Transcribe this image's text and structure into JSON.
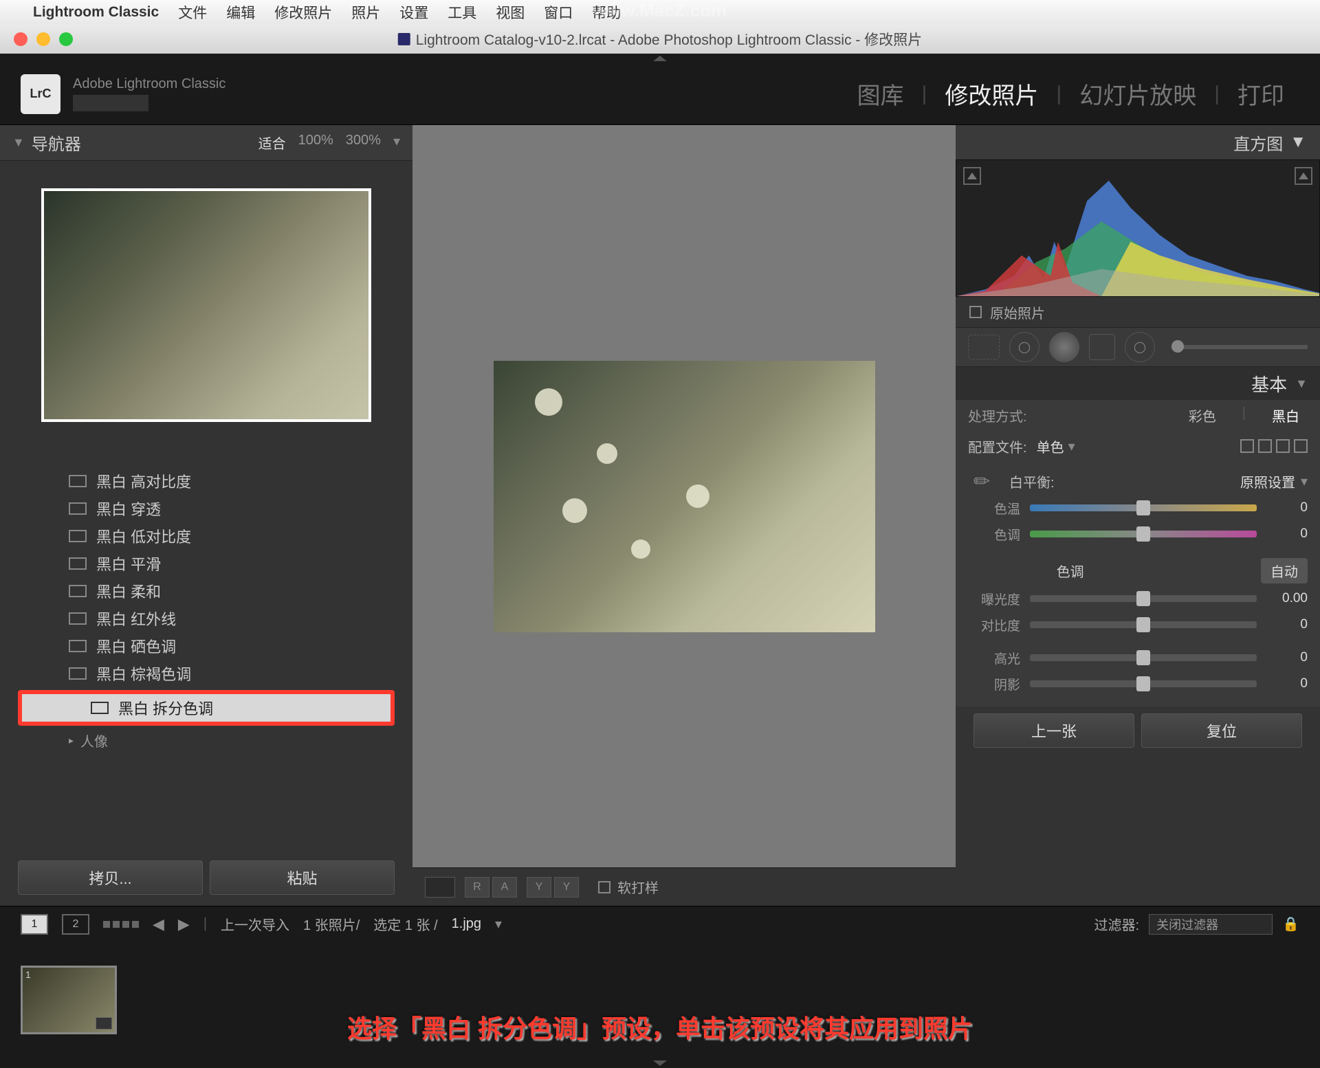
{
  "macos_menu": {
    "app": "Lightroom Classic",
    "items": [
      "文件",
      "编辑",
      "修改照片",
      "照片",
      "设置",
      "工具",
      "视图",
      "窗口",
      "帮助"
    ]
  },
  "window": {
    "title": "Lightroom Catalog-v10-2.lrcat - Adobe Photoshop Lightroom Classic - 修改照片"
  },
  "watermark": "www.MacZ.com",
  "header": {
    "badge": "LrC",
    "brand": "Adobe Lightroom Classic",
    "modules": [
      "图库",
      "修改照片",
      "幻灯片放映",
      "打印"
    ],
    "active_module": "修改照片"
  },
  "left": {
    "navigator": {
      "title": "导航器",
      "zooms": [
        "适合",
        "100%",
        "300%"
      ],
      "active_zoom": "适合"
    },
    "presets": [
      "黑白 高对比度",
      "黑白 穿透",
      "黑白 低对比度",
      "黑白 平滑",
      "黑白 柔和",
      "黑白 红外线",
      "黑白 硒色调",
      "黑白 棕褐色调",
      "黑白 拆分色调"
    ],
    "selected_preset": "黑白 拆分色调",
    "preset_subgroup": "人像",
    "buttons": {
      "copy": "拷贝...",
      "paste": "粘贴"
    }
  },
  "canvas": {
    "soft_proof": "软打样",
    "tb_labels": [
      "R",
      "A",
      "Y",
      "Y"
    ]
  },
  "right": {
    "histogram": "直方图",
    "original_label": "原始照片",
    "basic": {
      "title": "基本",
      "treatment": {
        "label": "处理方式:",
        "color": "彩色",
        "bw": "黑白",
        "selected": "黑白"
      },
      "profile": {
        "label": "配置文件:",
        "value": "单色"
      },
      "wb": {
        "label": "白平衡:",
        "value": "原照设置",
        "temp_label": "色温",
        "temp_val": "0",
        "tint_label": "色调",
        "tint_val": "0"
      },
      "tone": {
        "title": "色调",
        "auto": "自动",
        "exposure": {
          "label": "曝光度",
          "val": "0.00"
        },
        "contrast": {
          "label": "对比度",
          "val": "0"
        },
        "highlights": {
          "label": "高光",
          "val": "0"
        },
        "shadows": {
          "label": "阴影",
          "val": "0"
        }
      }
    },
    "buttons": {
      "prev": "上一张",
      "reset": "复位"
    }
  },
  "filmstrip": {
    "view1": "1",
    "view2": "2",
    "breadcrumb": "上一次导入",
    "count": "1 张照片/",
    "selected": "选定 1 张 /",
    "filename": "1.jpg",
    "filter_label": "过滤器:",
    "filter_value": "关闭过滤器",
    "thumb_index": "1"
  },
  "caption": "选择「黑白 拆分色调」预设，单击该预设将其应用到照片"
}
